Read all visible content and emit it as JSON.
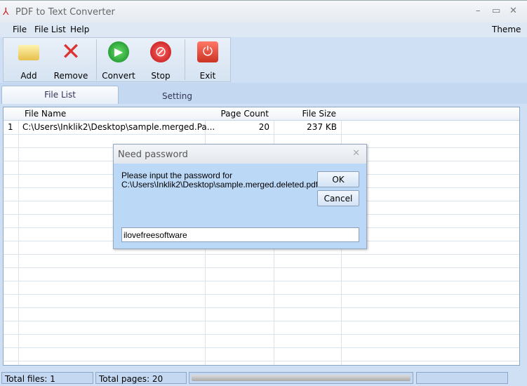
{
  "window": {
    "title": "PDF to Text Converter",
    "icon": "pdf-icon"
  },
  "menu": {
    "file": "File",
    "file_list": "File List",
    "help": "Help",
    "theme": "Theme"
  },
  "toolbar": {
    "add": "Add",
    "remove": "Remove",
    "convert": "Convert",
    "stop": "Stop",
    "exit": "Exit"
  },
  "tabs": {
    "file_list": "File List",
    "setting": "Setting"
  },
  "table": {
    "headers": {
      "num": "",
      "name": "File Name",
      "pages": "Page Count",
      "size": "File Size"
    },
    "rows": [
      {
        "num": "1",
        "name": "C:\\Users\\Inklik2\\Desktop\\sample.merged.Pa...",
        "pages": "20",
        "size": "237 KB"
      }
    ]
  },
  "dialog": {
    "title": "Need password",
    "message_line1": "Please input the password for",
    "message_line2": "C:\\Users\\Inklik2\\Desktop\\sample.merged.deleted.pdf",
    "ok": "OK",
    "cancel": "Cancel",
    "password_value": "ilovefreesoftware"
  },
  "status": {
    "total_files": "Total files: 1",
    "total_pages": "Total pages: 20",
    "progress": 0
  }
}
